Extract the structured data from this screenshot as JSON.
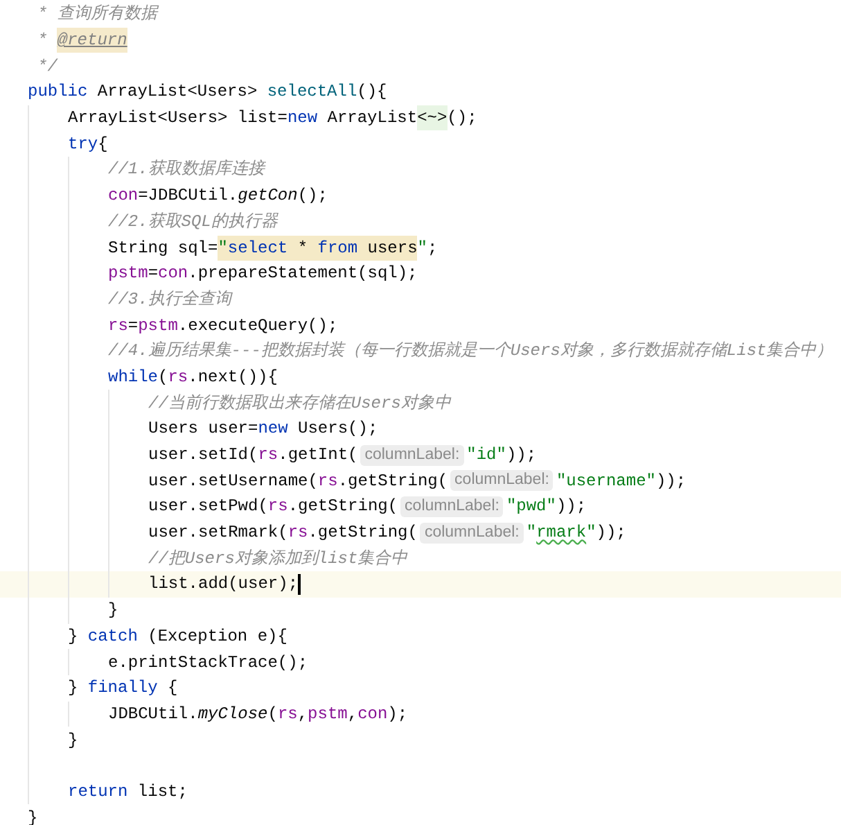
{
  "editor": {
    "lines": [
      {
        "kind": "doc",
        "tokens": [
          {
            "text": "* 查询所有数据",
            "kind": "comment"
          }
        ]
      },
      {
        "kind": "doc",
        "tokens": [
          {
            "text": "* ",
            "kind": "comment"
          },
          {
            "text": "@return",
            "kind": "doc-tag"
          }
        ]
      },
      {
        "kind": "doc",
        "tokens": [
          {
            "text": "*/",
            "kind": "comment"
          }
        ]
      },
      {
        "kind": "code",
        "tokens": [
          {
            "text": "public",
            "kind": "keyword"
          },
          {
            "text": " ArrayList<Users> ",
            "kind": "plain"
          },
          {
            "text": "selectAll",
            "kind": "method"
          },
          {
            "text": "(){",
            "kind": "plain"
          }
        ],
        "children": [
          {
            "kind": "code",
            "tokens": [
              {
                "text": "ArrayList<Users> list=",
                "kind": "plain"
              },
              {
                "text": "new",
                "kind": "keyword"
              },
              {
                "text": " ArrayList",
                "kind": "plain"
              },
              {
                "text": "<~>",
                "kind": "diamond"
              },
              {
                "text": "();",
                "kind": "plain"
              }
            ]
          },
          {
            "kind": "code",
            "tokens": [
              {
                "text": "try",
                "kind": "keyword"
              },
              {
                "text": "{",
                "kind": "plain"
              }
            ],
            "children": [
              {
                "kind": "code",
                "tokens": [
                  {
                    "text": "//1.获取数据库连接",
                    "kind": "comment"
                  }
                ]
              },
              {
                "kind": "code",
                "tokens": [
                  {
                    "text": "con",
                    "kind": "field"
                  },
                  {
                    "text": "=JDBCUtil.",
                    "kind": "plain"
                  },
                  {
                    "text": "getCon",
                    "kind": "static"
                  },
                  {
                    "text": "();",
                    "kind": "plain"
                  }
                ]
              },
              {
                "kind": "code",
                "tokens": [
                  {
                    "text": "//2.获取SQL的执行器",
                    "kind": "comment"
                  }
                ]
              },
              {
                "kind": "code",
                "tokens": [
                  {
                    "text": "String sql=",
                    "kind": "plain"
                  },
                  {
                    "text": "\"",
                    "kind": "string-injected"
                  },
                  {
                    "text": "select",
                    "kind": "sql-keyword"
                  },
                  {
                    "text": " * ",
                    "kind": "sql"
                  },
                  {
                    "text": "from",
                    "kind": "sql-keyword"
                  },
                  {
                    "text": " users",
                    "kind": "sql"
                  },
                  {
                    "text": "\"",
                    "kind": "string"
                  },
                  {
                    "text": ";",
                    "kind": "plain"
                  }
                ]
              },
              {
                "kind": "code",
                "tokens": [
                  {
                    "text": "pstm",
                    "kind": "field"
                  },
                  {
                    "text": "=",
                    "kind": "plain"
                  },
                  {
                    "text": "con",
                    "kind": "field"
                  },
                  {
                    "text": ".prepareStatement(sql);",
                    "kind": "plain"
                  }
                ]
              },
              {
                "kind": "code",
                "tokens": [
                  {
                    "text": "//3.执行全查询",
                    "kind": "comment"
                  }
                ]
              },
              {
                "kind": "code",
                "tokens": [
                  {
                    "text": "rs",
                    "kind": "field"
                  },
                  {
                    "text": "=",
                    "kind": "plain"
                  },
                  {
                    "text": "pstm",
                    "kind": "field"
                  },
                  {
                    "text": ".executeQuery();",
                    "kind": "plain"
                  }
                ]
              },
              {
                "kind": "code",
                "tokens": [
                  {
                    "text": "//4.遍历结果集---把数据封装（每一行数据就是一个Users对象，多行数据就存储List集合中）",
                    "kind": "comment"
                  }
                ]
              },
              {
                "kind": "code",
                "tokens": [
                  {
                    "text": "while",
                    "kind": "keyword"
                  },
                  {
                    "text": "(",
                    "kind": "plain"
                  },
                  {
                    "text": "rs",
                    "kind": "field"
                  },
                  {
                    "text": ".next()){",
                    "kind": "plain"
                  }
                ],
                "children": [
                  {
                    "kind": "code",
                    "tokens": [
                      {
                        "text": "//当前行数据取出来存储在Users对象中",
                        "kind": "comment"
                      }
                    ]
                  },
                  {
                    "kind": "code",
                    "tokens": [
                      {
                        "text": "Users user=",
                        "kind": "plain"
                      },
                      {
                        "text": "new",
                        "kind": "keyword"
                      },
                      {
                        "text": " Users();",
                        "kind": "plain"
                      }
                    ]
                  },
                  {
                    "kind": "code",
                    "tokens": [
                      {
                        "text": "user.setId(",
                        "kind": "plain"
                      },
                      {
                        "text": "rs",
                        "kind": "field"
                      },
                      {
                        "text": ".getInt(",
                        "kind": "plain"
                      },
                      {
                        "text": "columnLabel:",
                        "kind": "hint"
                      },
                      {
                        "text": "\"id\"",
                        "kind": "string"
                      },
                      {
                        "text": "));",
                        "kind": "plain"
                      }
                    ]
                  },
                  {
                    "kind": "code",
                    "tokens": [
                      {
                        "text": "user.setUsername(",
                        "kind": "plain"
                      },
                      {
                        "text": "rs",
                        "kind": "field"
                      },
                      {
                        "text": ".getString(",
                        "kind": "plain"
                      },
                      {
                        "text": "columnLabel:",
                        "kind": "hint"
                      },
                      {
                        "text": "\"username\"",
                        "kind": "string"
                      },
                      {
                        "text": "));",
                        "kind": "plain"
                      }
                    ]
                  },
                  {
                    "kind": "code",
                    "tokens": [
                      {
                        "text": "user.setPwd(",
                        "kind": "plain"
                      },
                      {
                        "text": "rs",
                        "kind": "field"
                      },
                      {
                        "text": ".getString(",
                        "kind": "plain"
                      },
                      {
                        "text": "columnLabel:",
                        "kind": "hint"
                      },
                      {
                        "text": "\"pwd\"",
                        "kind": "string"
                      },
                      {
                        "text": "));",
                        "kind": "plain"
                      }
                    ]
                  },
                  {
                    "kind": "code",
                    "tokens": [
                      {
                        "text": "user.setRmark(",
                        "kind": "plain"
                      },
                      {
                        "text": "rs",
                        "kind": "field"
                      },
                      {
                        "text": ".getString(",
                        "kind": "plain"
                      },
                      {
                        "text": "columnLabel:",
                        "kind": "hint"
                      },
                      {
                        "text": "\"",
                        "kind": "string"
                      },
                      {
                        "text": "rmark",
                        "kind": "string-typo"
                      },
                      {
                        "text": "\"",
                        "kind": "string"
                      },
                      {
                        "text": "));",
                        "kind": "plain"
                      }
                    ]
                  },
                  {
                    "kind": "code",
                    "tokens": [
                      {
                        "text": "//把Users对象添加到list集合中",
                        "kind": "comment"
                      }
                    ]
                  },
                  {
                    "kind": "code",
                    "current": true,
                    "tokens": [
                      {
                        "text": "list.add(user);",
                        "kind": "plain"
                      }
                    ]
                  }
                ]
              },
              {
                "kind": "code",
                "tokens": [
                  {
                    "text": "}",
                    "kind": "plain"
                  }
                ]
              }
            ]
          },
          {
            "kind": "code",
            "tokens": [
              {
                "text": "} ",
                "kind": "plain"
              },
              {
                "text": "catch",
                "kind": "keyword"
              },
              {
                "text": " (Exception e){",
                "kind": "plain"
              }
            ],
            "children": [
              {
                "kind": "code",
                "tokens": [
                  {
                    "text": "e.printStackTrace();",
                    "kind": "plain"
                  }
                ]
              }
            ]
          },
          {
            "kind": "code",
            "tokens": [
              {
                "text": "} ",
                "kind": "plain"
              },
              {
                "text": "finally",
                "kind": "keyword"
              },
              {
                "text": " {",
                "kind": "plain"
              }
            ],
            "children": [
              {
                "kind": "code",
                "tokens": [
                  {
                    "text": "JDBCUtil.",
                    "kind": "plain"
                  },
                  {
                    "text": "myClose",
                    "kind": "static"
                  },
                  {
                    "text": "(",
                    "kind": "plain"
                  },
                  {
                    "text": "rs",
                    "kind": "field"
                  },
                  {
                    "text": ",",
                    "kind": "plain"
                  },
                  {
                    "text": "pstm",
                    "kind": "field"
                  },
                  {
                    "text": ",",
                    "kind": "plain"
                  },
                  {
                    "text": "con",
                    "kind": "field"
                  },
                  {
                    "text": ");",
                    "kind": "plain"
                  }
                ]
              }
            ]
          },
          {
            "kind": "code",
            "tokens": [
              {
                "text": "}",
                "kind": "plain"
              }
            ]
          },
          {
            "kind": "blank"
          },
          {
            "kind": "code",
            "tokens": [
              {
                "text": "return",
                "kind": "keyword"
              },
              {
                "text": " list;",
                "kind": "plain"
              }
            ]
          }
        ]
      },
      {
        "kind": "code",
        "tokens": [
          {
            "text": "}",
            "kind": "plain"
          }
        ]
      }
    ]
  }
}
